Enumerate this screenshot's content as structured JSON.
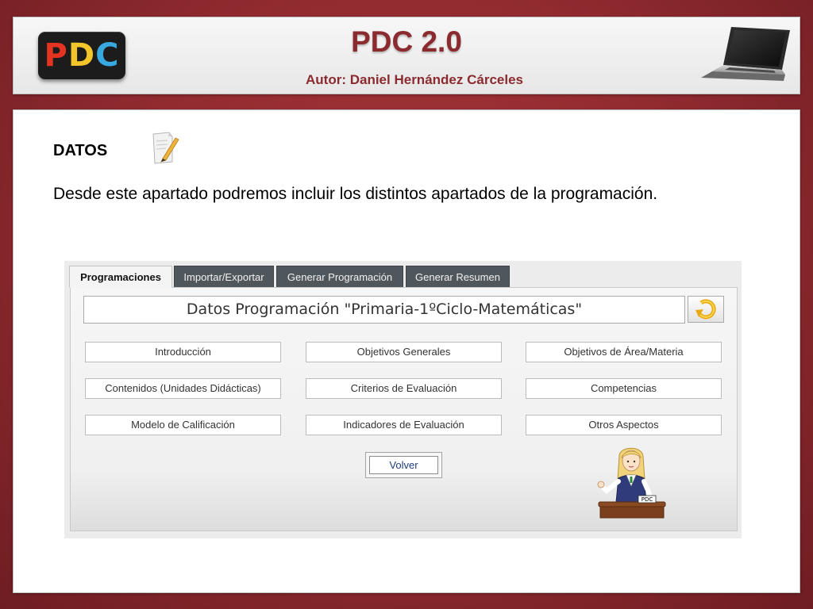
{
  "header": {
    "logo": {
      "p": "P",
      "d": "D",
      "c": "C",
      "text": "PDC"
    },
    "title": "PDC 2.0",
    "author": "Autor:  Daniel Hernández Cárceles"
  },
  "content": {
    "section_title": "DATOS",
    "description": "Desde este apartado podremos incluir los distintos apartados de la programación."
  },
  "app": {
    "tabs": [
      {
        "label": "Programaciones",
        "active": true
      },
      {
        "label": "Importar/Exportar",
        "active": false
      },
      {
        "label": "Generar Programación",
        "active": false
      },
      {
        "label": "Generar Resumen",
        "active": false
      }
    ],
    "programming_title": "Datos Programación \"Primaria-1ºCiclo-Matemáticas\"",
    "options": [
      "Introducción",
      "Objetivos Generales",
      "Objetivos de Área/Materia",
      "Contenidos (Unidades Didácticas)",
      "Criterios de Evaluación",
      "Competencias",
      "Modelo de Calificación",
      "Indicadores de Evaluación",
      "Otros Aspectos"
    ],
    "back_label": "Volver",
    "desk_sign": "PDC"
  },
  "colors": {
    "background": "#9b2f34",
    "title_text": "#8b2a2f",
    "tab_inactive": "#4f565c",
    "logo_p": "#e53322",
    "logo_d": "#f2c62a",
    "logo_c": "#38a8e0"
  },
  "icons": [
    "laptop-icon",
    "document-pencil-icon",
    "refresh-arrow-icon",
    "teacher-illustration"
  ]
}
